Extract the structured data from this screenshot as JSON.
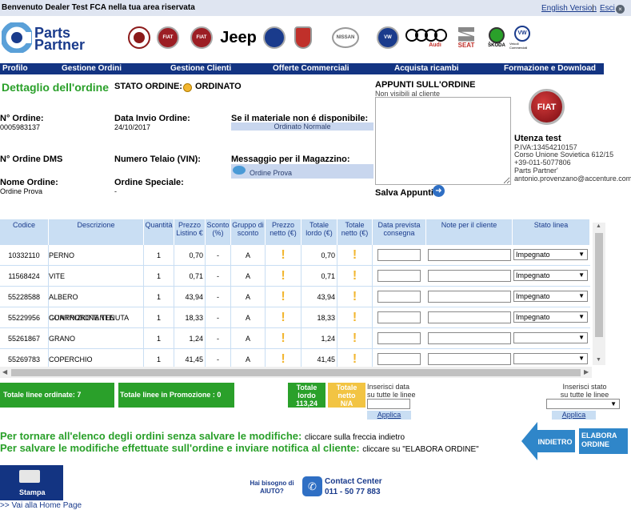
{
  "topbar": {
    "welcome": "Benvenuto Dealer Test FCA nella tua area riservata",
    "english": "English Version",
    "separator": "|",
    "exit": "Esci",
    "exit_icon": "close-icon"
  },
  "logo": {
    "line1": "Parts",
    "line2": "Partner"
  },
  "brands": [
    {
      "name": "alfa-romeo-logo",
      "color": "#8c1a1a"
    },
    {
      "name": "fiat-logo",
      "color": "#9c1e24"
    },
    {
      "name": "fiat-professional-logo",
      "color": "#9c1e24"
    },
    {
      "name": "jeep-logo",
      "label": "Jeep"
    },
    {
      "name": "lancia-logo",
      "color": "#1a3b8c"
    },
    {
      "name": "abarth-logo",
      "color": "#c0302a"
    },
    {
      "name": "nissan-logo",
      "label": "NISSAN"
    },
    {
      "name": "volkswagen-logo",
      "color": "#1a3b8c"
    },
    {
      "name": "audi-logo",
      "label": "Audi"
    },
    {
      "name": "seat-logo",
      "label": "SEAT"
    },
    {
      "name": "skoda-logo",
      "label": "ŠKODA"
    },
    {
      "name": "vw-commercial-logo",
      "label": "Veicoli Commerciali"
    }
  ],
  "nav": [
    "Profilo",
    "Gestione Ordini",
    "Gestione Clienti",
    "Offerte Commerciali",
    "Acquista ricambi",
    "Formazione e Download"
  ],
  "order": {
    "title": "Dettaglio dell'ordine",
    "status_label": "STATO ORDINE:",
    "status_value": "ORDINATO",
    "order_no_label": "N° Ordine:",
    "order_no_value": "0005983137",
    "send_date_label": "Data Invio Ordine:",
    "send_date_value": "24/10/2017",
    "material_label": "Se il materiale non é disponibile:",
    "material_value": "Ordinato Normale",
    "dms_label": "N° Ordine DMS",
    "chassis_label": "Numero Telaio (VIN):",
    "message_label": "Messaggio per il Magazzino:",
    "message_value": "Ordine Prova",
    "name_label": "Nome Ordine:",
    "name_value": "Ordine Prova",
    "special_label": "Ordine Speciale:",
    "special_value": "-",
    "notes_title": "APPUNTI SULL'ORDINE",
    "notes_sub": "Non visibili al cliente",
    "save_notes": "Salva Appunti"
  },
  "user": {
    "brand": "FIAT",
    "name": "Utenza test",
    "lines": [
      "P.IVA:13454210157",
      "Corso Unione Sovietica 612/15",
      "+39-011-5077806",
      "Parts Partner'",
      "antonio.provenzano@accenture.com"
    ]
  },
  "table": {
    "headers": [
      "Codice",
      "Descrizione",
      "Quantità",
      "Prezzo Listino €",
      "Sconto (%)",
      "Gruppo di sconto",
      "Prezzo netto (€)",
      "Totale lordo (€)",
      "Totale netto (€)",
      "Data prevista consegna",
      "Note per il cliente",
      "Stato linea"
    ],
    "rows": [
      {
        "code": "10332110",
        "desc": "PERNO",
        "qty": "1",
        "price": "0,70",
        "discount": "-",
        "group": "A",
        "lordo": "0,70",
        "stato": "Impegnato"
      },
      {
        "code": "11568424",
        "desc": "VITE",
        "qty": "1",
        "price": "0,71",
        "discount": "-",
        "group": "A",
        "lordo": "0,71",
        "stato": "Impegnato"
      },
      {
        "code": "55228588",
        "desc": "ALBERO CONTROROTANTE",
        "qty": "1",
        "price": "43,94",
        "discount": "-",
        "group": "A",
        "lordo": "43,94",
        "stato": "Impegnato"
      },
      {
        "code": "55229956",
        "desc": "GUARNIZIONE TENUTA",
        "qty": "1",
        "price": "18,33",
        "discount": "-",
        "group": "A",
        "lordo": "18,33",
        "stato": "Impegnato"
      },
      {
        "code": "55261867",
        "desc": "GRANO",
        "qty": "1",
        "price": "1,24",
        "discount": "-",
        "group": "A",
        "lordo": "1,24",
        "stato": ""
      },
      {
        "code": "55269783",
        "desc": "COPERCHIO",
        "qty": "1",
        "price": "41,45",
        "discount": "-",
        "group": "A",
        "lordo": "41,45",
        "stato": ""
      }
    ]
  },
  "totals": {
    "lines": "Totale linee ordinate:   7",
    "promo": "Totale linee in Promozione :   0",
    "lordo_label": "Totale lordo",
    "lordo_value": "113,24",
    "netto_label": "Totale netto",
    "netto_value": "N/A",
    "date_all": "Inserisci data su tutte le linee",
    "state_all": "Inserisci stato su tutte le linee",
    "apply": "Applica"
  },
  "instructions": {
    "line1_green": "Per tornare all'elenco degli ordini senza salvare le modifiche:",
    "line1_black": "cliccare sulla freccia indietro",
    "line2_green": "Per salvare le modifiche effettuate sull'ordine e inviare notifica al cliente:",
    "line2_black": "cliccare su \"ELABORA ORDINE\"",
    "back": "INDIETRO",
    "process": "ELABORA ORDINE"
  },
  "footer": {
    "print": "Stampa",
    "home": ">> Vai alla Home Page",
    "help": "Hai bisogno di AIUTO?",
    "contact_title": "Contact Center",
    "contact_number": "011 - 50 77 883"
  }
}
